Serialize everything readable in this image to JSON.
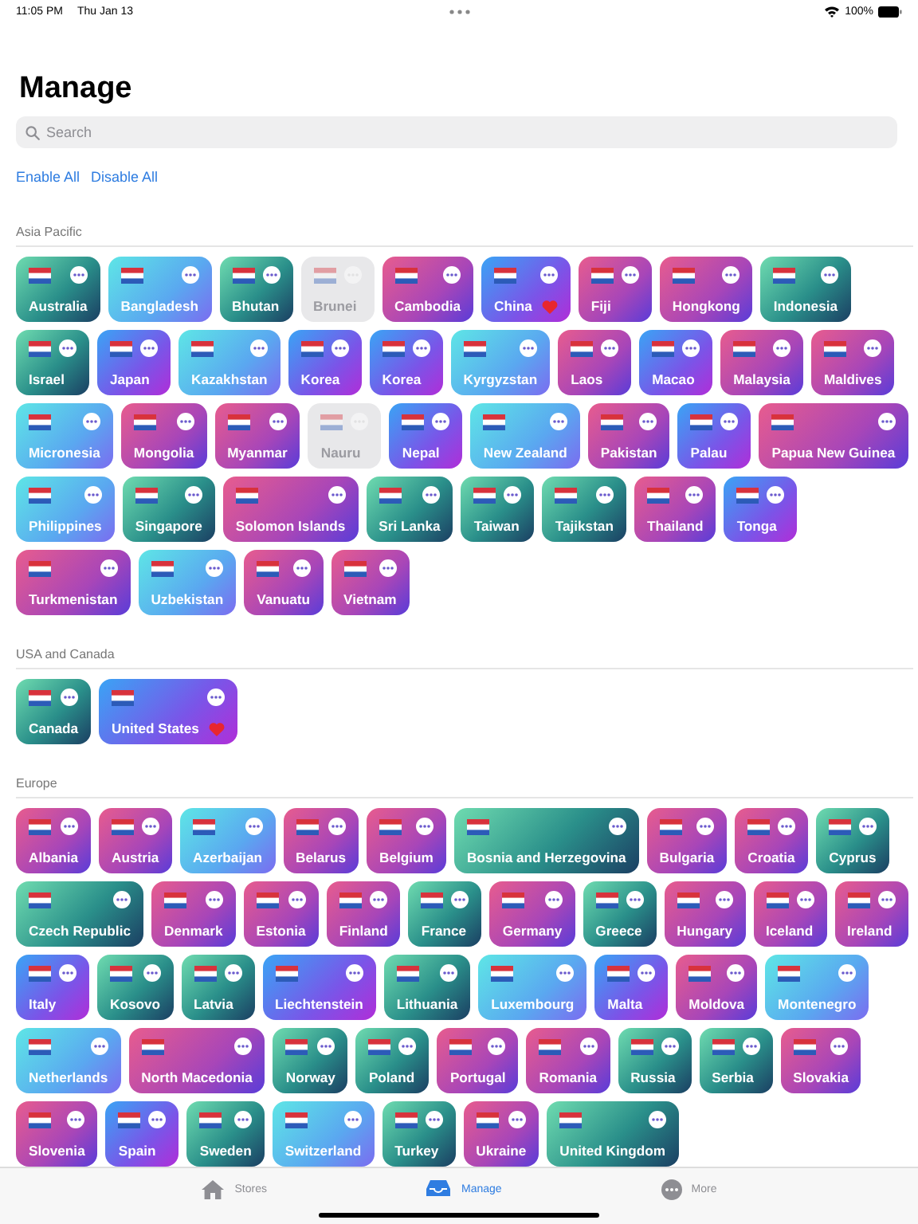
{
  "status_bar": {
    "time": "11:05 PM",
    "date": "Thu Jan 13",
    "battery": "100%"
  },
  "title": "Manage",
  "search": {
    "placeholder": "Search"
  },
  "actions": [
    "Enable All",
    "Disable All"
  ],
  "sections": [
    {
      "title": "Asia Pacific",
      "items": [
        {
          "name": "Australia",
          "kind": "teal",
          "enabled": true,
          "favorite": false
        },
        {
          "name": "Bangladesh",
          "kind": "cyan",
          "enabled": true,
          "favorite": false
        },
        {
          "name": "Bhutan",
          "kind": "teal",
          "enabled": true,
          "favorite": false
        },
        {
          "name": "Brunei",
          "enabled": false,
          "favorite": false
        },
        {
          "name": "Cambodia",
          "kind": "pink",
          "enabled": true,
          "favorite": false
        },
        {
          "name": "China",
          "kind": "blue",
          "enabled": true,
          "favorite": true
        },
        {
          "name": "Fiji",
          "kind": "pink",
          "enabled": true,
          "favorite": false
        },
        {
          "name": "Hongkong",
          "kind": "pink",
          "enabled": true,
          "favorite": false
        },
        {
          "name": "Indonesia",
          "kind": "teal",
          "enabled": true,
          "favorite": false
        },
        {
          "name": "Israel",
          "kind": "teal",
          "enabled": true,
          "favorite": false
        },
        {
          "name": "Japan",
          "kind": "blue",
          "enabled": true,
          "favorite": false
        },
        {
          "name": "Kazakhstan",
          "kind": "cyan",
          "enabled": true,
          "favorite": false
        },
        {
          "name": "Korea",
          "kind": "blue",
          "enabled": true,
          "favorite": false
        },
        {
          "name": "Korea",
          "kind": "blue",
          "enabled": true,
          "favorite": false
        },
        {
          "name": "Kyrgyzstan",
          "kind": "cyan",
          "enabled": true,
          "favorite": false
        },
        {
          "name": "Laos",
          "kind": "pink",
          "enabled": true,
          "favorite": false
        },
        {
          "name": "Macao",
          "kind": "blue",
          "enabled": true,
          "favorite": false
        },
        {
          "name": "Malaysia",
          "kind": "pink",
          "enabled": true,
          "favorite": false
        },
        {
          "name": "Maldives",
          "kind": "pink",
          "enabled": true,
          "favorite": false
        },
        {
          "name": "Micronesia",
          "kind": "cyan",
          "enabled": true,
          "favorite": false
        },
        {
          "name": "Mongolia",
          "kind": "pink",
          "enabled": true,
          "favorite": false
        },
        {
          "name": "Myanmar",
          "kind": "pink",
          "enabled": true,
          "favorite": false
        },
        {
          "name": "Nauru",
          "enabled": false,
          "favorite": false
        },
        {
          "name": "Nepal",
          "kind": "blue",
          "enabled": true,
          "favorite": false
        },
        {
          "name": "New Zealand",
          "kind": "cyan",
          "enabled": true,
          "favorite": false
        },
        {
          "name": "Pakistan",
          "kind": "pink",
          "enabled": true,
          "favorite": false
        },
        {
          "name": "Palau",
          "kind": "blue",
          "enabled": true,
          "favorite": false
        },
        {
          "name": "Papua New Guinea",
          "kind": "pink",
          "enabled": true,
          "favorite": false
        },
        {
          "name": "Philippines",
          "kind": "cyan",
          "enabled": true,
          "favorite": false
        },
        {
          "name": "Singapore",
          "kind": "teal",
          "enabled": true,
          "favorite": false
        },
        {
          "name": "Solomon Islands",
          "kind": "pink",
          "enabled": true,
          "favorite": false
        },
        {
          "name": "Sri Lanka",
          "kind": "teal",
          "enabled": true,
          "favorite": false
        },
        {
          "name": "Taiwan",
          "kind": "teal",
          "enabled": true,
          "favorite": false
        },
        {
          "name": "Tajikstan",
          "kind": "teal",
          "enabled": true,
          "favorite": false
        },
        {
          "name": "Thailand",
          "kind": "pink",
          "enabled": true,
          "favorite": false
        },
        {
          "name": "Tonga",
          "kind": "blue",
          "enabled": true,
          "favorite": false
        },
        {
          "name": "Turkmenistan",
          "kind": "pink",
          "enabled": true,
          "favorite": false
        },
        {
          "name": "Uzbekistan",
          "kind": "cyan",
          "enabled": true,
          "favorite": false
        },
        {
          "name": "Vanuatu",
          "kind": "pink",
          "enabled": true,
          "favorite": false
        },
        {
          "name": "Vietnam",
          "kind": "pink",
          "enabled": true,
          "favorite": false
        }
      ]
    },
    {
      "title": "USA and Canada",
      "items": [
        {
          "name": "Canada",
          "kind": "teal",
          "enabled": true,
          "favorite": false
        },
        {
          "name": "United States",
          "kind": "blue",
          "enabled": true,
          "favorite": true
        }
      ]
    },
    {
      "title": "Europe",
      "items": [
        {
          "name": "Albania",
          "kind": "pink",
          "enabled": true,
          "favorite": false
        },
        {
          "name": "Austria",
          "kind": "pink",
          "enabled": true,
          "favorite": false
        },
        {
          "name": "Azerbaijan",
          "kind": "cyan",
          "enabled": true,
          "favorite": false
        },
        {
          "name": "Belarus",
          "kind": "pink",
          "enabled": true,
          "favorite": false
        },
        {
          "name": "Belgium",
          "kind": "pink",
          "enabled": true,
          "favorite": false
        },
        {
          "name": "Bosnia and Herzegovina",
          "kind": "teal",
          "enabled": true,
          "favorite": false
        },
        {
          "name": "Bulgaria",
          "kind": "pink",
          "enabled": true,
          "favorite": false
        },
        {
          "name": "Croatia",
          "kind": "pink",
          "enabled": true,
          "favorite": false
        },
        {
          "name": "Cyprus",
          "kind": "teal",
          "enabled": true,
          "favorite": false
        },
        {
          "name": "Czech Republic",
          "kind": "teal",
          "enabled": true,
          "favorite": false
        },
        {
          "name": "Denmark",
          "kind": "pink",
          "enabled": true,
          "favorite": false
        },
        {
          "name": "Estonia",
          "kind": "pink",
          "enabled": true,
          "favorite": false
        },
        {
          "name": "Finland",
          "kind": "pink",
          "enabled": true,
          "favorite": false
        },
        {
          "name": "France",
          "kind": "teal",
          "enabled": true,
          "favorite": false
        },
        {
          "name": "Germany",
          "kind": "pink",
          "enabled": true,
          "favorite": false
        },
        {
          "name": "Greece",
          "kind": "teal",
          "enabled": true,
          "favorite": false
        },
        {
          "name": "Hungary",
          "kind": "pink",
          "enabled": true,
          "favorite": false
        },
        {
          "name": "Iceland",
          "kind": "pink",
          "enabled": true,
          "favorite": false
        },
        {
          "name": "Ireland",
          "kind": "pink",
          "enabled": true,
          "favorite": false
        },
        {
          "name": "Italy",
          "kind": "blue",
          "enabled": true,
          "favorite": false
        },
        {
          "name": "Kosovo",
          "kind": "teal",
          "enabled": true,
          "favorite": false
        },
        {
          "name": "Latvia",
          "kind": "teal",
          "enabled": true,
          "favorite": false
        },
        {
          "name": "Liechtenstein",
          "kind": "blue",
          "enabled": true,
          "favorite": false
        },
        {
          "name": "Lithuania",
          "kind": "teal",
          "enabled": true,
          "favorite": false
        },
        {
          "name": "Luxembourg",
          "kind": "cyan",
          "enabled": true,
          "favorite": false
        },
        {
          "name": "Malta",
          "kind": "blue",
          "enabled": true,
          "favorite": false
        },
        {
          "name": "Moldova",
          "kind": "pink",
          "enabled": true,
          "favorite": false
        },
        {
          "name": "Montenegro",
          "kind": "cyan",
          "enabled": true,
          "favorite": false
        },
        {
          "name": "Netherlands",
          "kind": "cyan",
          "enabled": true,
          "favorite": false
        },
        {
          "name": "North Macedonia",
          "kind": "pink",
          "enabled": true,
          "favorite": false
        },
        {
          "name": "Norway",
          "kind": "teal",
          "enabled": true,
          "favorite": false
        },
        {
          "name": "Poland",
          "kind": "teal",
          "enabled": true,
          "favorite": false
        },
        {
          "name": "Portugal",
          "kind": "pink",
          "enabled": true,
          "favorite": false
        },
        {
          "name": "Romania",
          "kind": "pink",
          "enabled": true,
          "favorite": false
        },
        {
          "name": "Russia",
          "kind": "teal",
          "enabled": true,
          "favorite": false
        },
        {
          "name": "Serbia",
          "kind": "teal",
          "enabled": true,
          "favorite": false
        },
        {
          "name": "Slovakia",
          "kind": "pink",
          "enabled": true,
          "favorite": false
        },
        {
          "name": "Slovenia",
          "kind": "pink",
          "enabled": true,
          "favorite": false
        },
        {
          "name": "Spain",
          "kind": "blue",
          "enabled": true,
          "favorite": false
        },
        {
          "name": "Sweden",
          "kind": "teal",
          "enabled": true,
          "favorite": false
        },
        {
          "name": "Switzerland",
          "kind": "cyan",
          "enabled": true,
          "favorite": false
        },
        {
          "name": "Turkey",
          "kind": "teal",
          "enabled": true,
          "favorite": false
        },
        {
          "name": "Ukraine",
          "kind": "pink",
          "enabled": true,
          "favorite": false
        },
        {
          "name": "United Kingdom",
          "kind": "teal",
          "enabled": true,
          "favorite": false
        }
      ]
    }
  ],
  "tab_bar": [
    {
      "label": "Stores",
      "kind": "home",
      "selected": false
    },
    {
      "label": "Manage",
      "kind": "tray",
      "selected": true
    },
    {
      "label": "More",
      "kind": "more",
      "selected": false
    }
  ]
}
